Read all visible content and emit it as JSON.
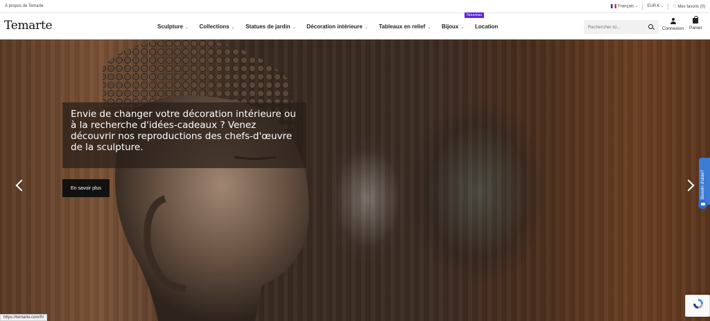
{
  "topbar": {
    "about_link": "À propos de Temarte",
    "language": "Français",
    "currency": "EUR €",
    "favorites": "Mes favoris (0)"
  },
  "header": {
    "logo": "Temarte",
    "nav": [
      {
        "label": "Sculpture",
        "has_dropdown": true
      },
      {
        "label": "Collections",
        "has_dropdown": true
      },
      {
        "label": "Statues de jardin",
        "has_dropdown": true
      },
      {
        "label": "Décoration intérieure",
        "has_dropdown": true
      },
      {
        "label": "Tableaux en relief",
        "has_dropdown": true
      },
      {
        "label": "Bijoux",
        "has_dropdown": true
      },
      {
        "label": "Location",
        "has_dropdown": false
      }
    ],
    "new_badge": "Nouveau",
    "search_placeholder": "Rechercher ici...",
    "login_label": "Connexion",
    "cart_label": "Panier"
  },
  "hero": {
    "caption": "Envie de changer votre décoration intérieure ou à la recherche d'idées-cadeaux ? Venez découvrir nos reproductions des chefs-d'œuvre de la sculpture.",
    "cta": "En savoir plus"
  },
  "help": {
    "tab_label": "Besoin d'aide?"
  },
  "status_bar": {
    "url": "https://temarte.com/fr/"
  },
  "colors": {
    "badge": "#5b21e8",
    "help_tab": "#3a7bd5",
    "cta_bg": "#111111"
  }
}
